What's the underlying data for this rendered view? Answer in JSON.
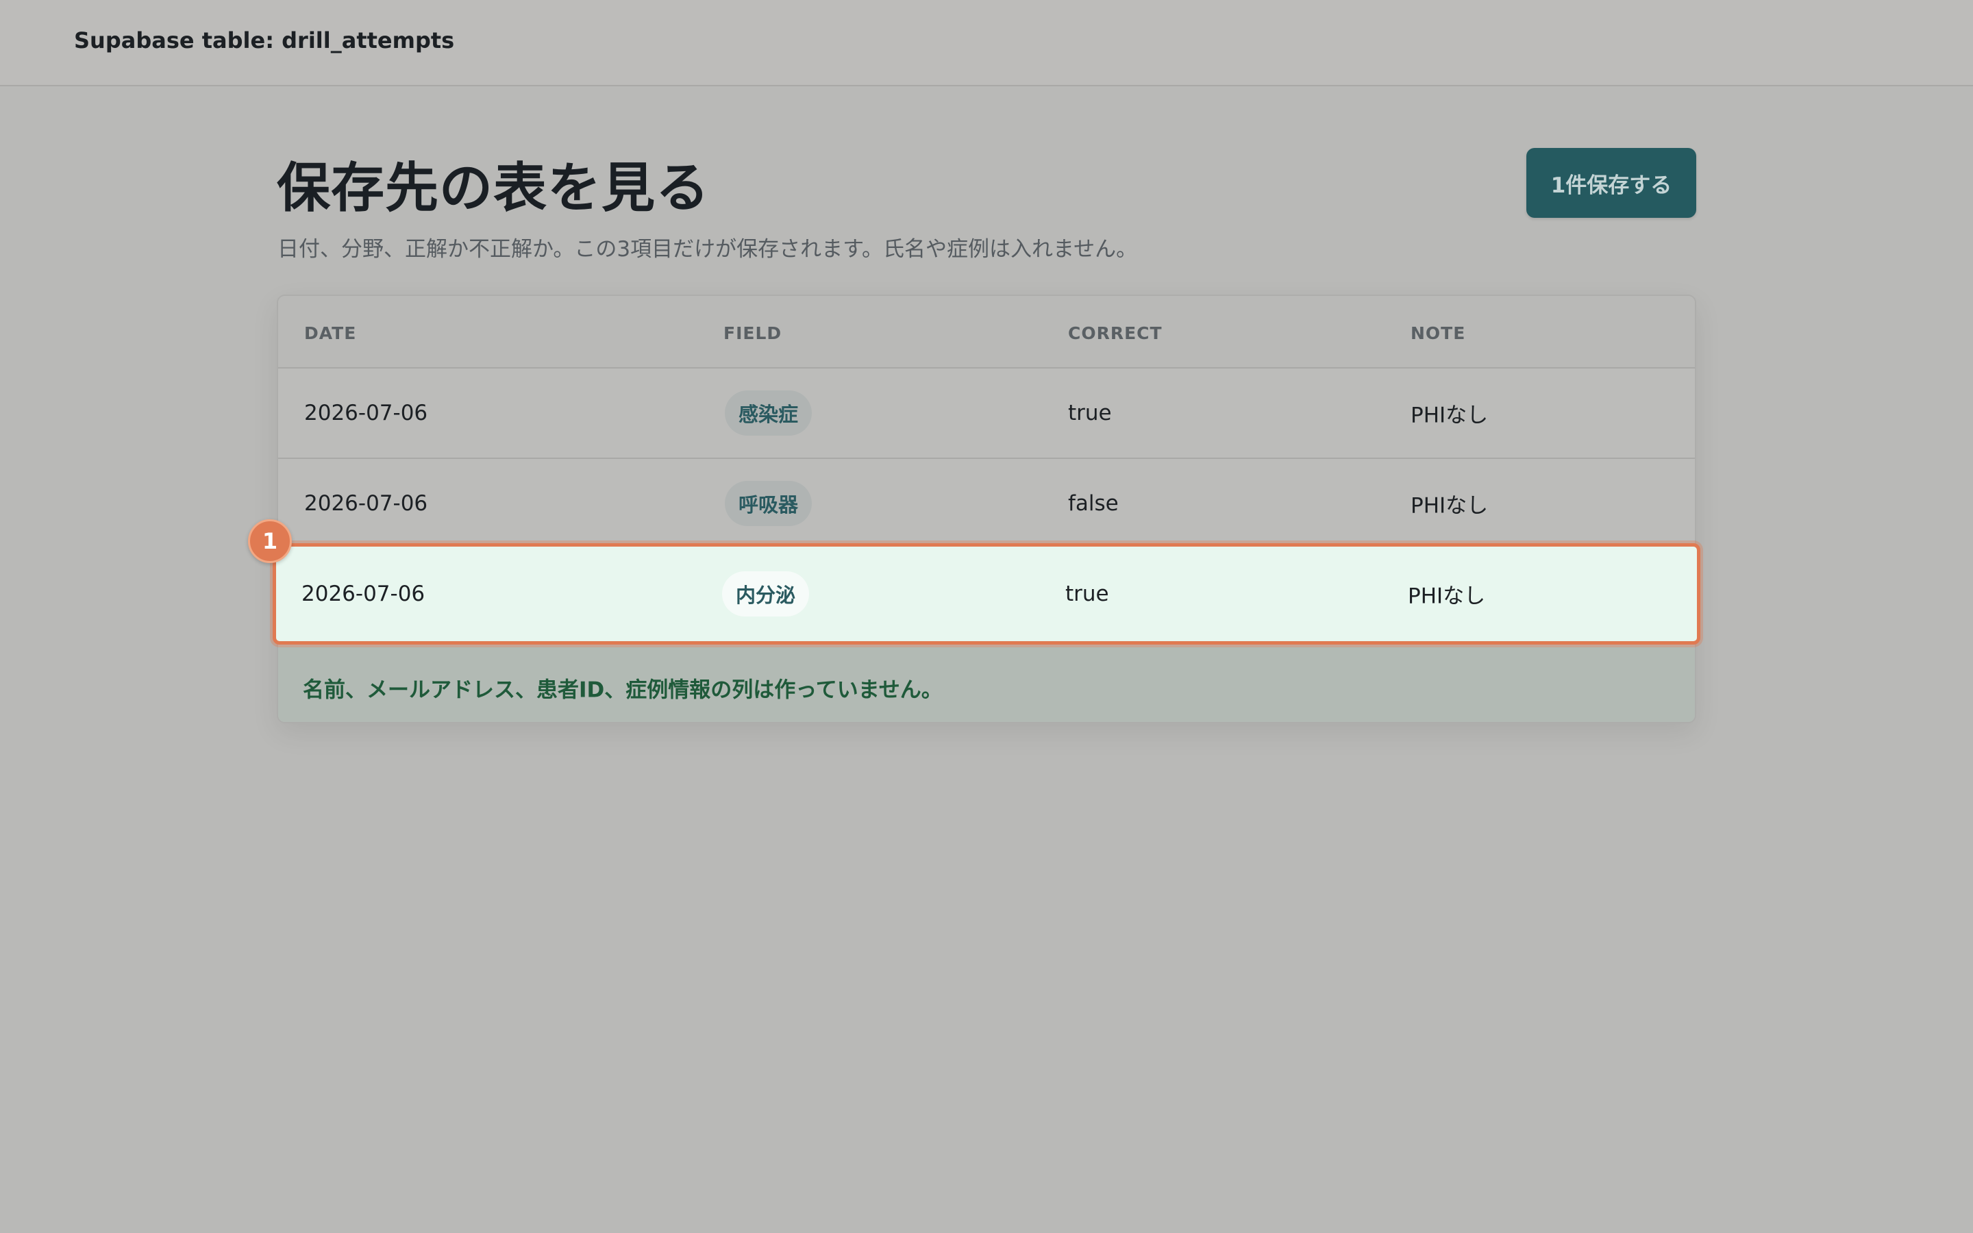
{
  "topbar": {
    "title": "Supabase table: drill_attempts"
  },
  "page": {
    "title": "保存先の表を見る",
    "subtitle": "日付、分野、正解か不正解か。この3項目だけが保存されます。氏名や症例は入れません。",
    "save_button": "1件保存する"
  },
  "table": {
    "columns": [
      "DATE",
      "FIELD",
      "CORRECT",
      "NOTE"
    ],
    "rows": [
      {
        "date": "2026-07-06",
        "field": "感染症",
        "correct": "true",
        "note": "PHIなし"
      },
      {
        "date": "2026-07-06",
        "field": "呼吸器",
        "correct": "false",
        "note": "PHIなし"
      },
      {
        "date": "2026-07-06",
        "field": "内分泌",
        "correct": "true",
        "note": "PHIなし"
      }
    ],
    "footer_note": "名前、メールアドレス、患者ID、症例情報の列は作っていません。"
  },
  "annotation": {
    "badge": "1",
    "color": "#e07a52"
  },
  "colors": {
    "accent": "#255a60",
    "highlight_bg": "#e8f7ef",
    "note_text": "#1f5a3a"
  }
}
